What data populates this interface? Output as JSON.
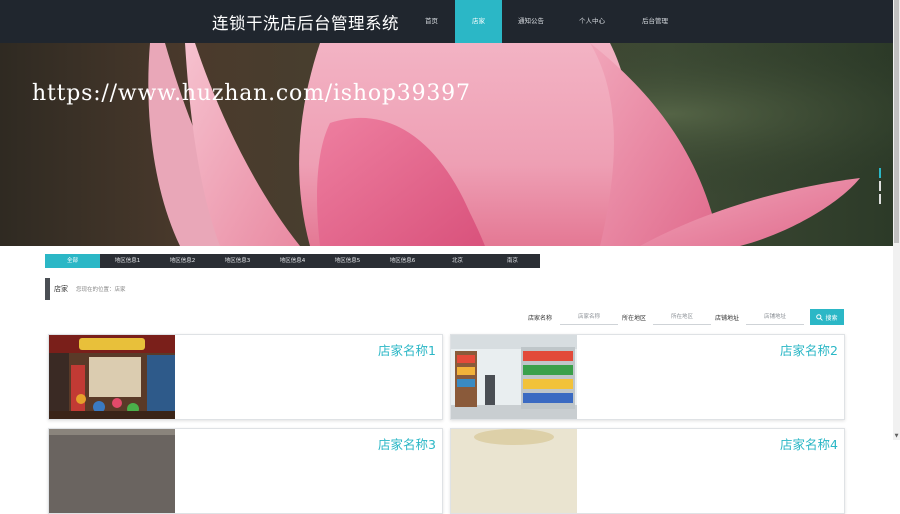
{
  "header": {
    "site_title": "连锁干洗店后台管理系统",
    "nav": [
      {
        "label": "首页",
        "active": false
      },
      {
        "label": "店家",
        "active": true
      },
      {
        "label": "通知公告",
        "active": false
      },
      {
        "label": "个人中心",
        "active": false
      },
      {
        "label": "后台管理",
        "active": false
      }
    ]
  },
  "banner": {
    "watermark": "https://www.huzhan.com/ishop39397",
    "active_slide": 1
  },
  "filter_tabs": [
    "全部",
    "地区信息1",
    "地区信息2",
    "地区信息3",
    "地区信息4",
    "地区信息5",
    "地区信息6",
    "北京",
    "南京"
  ],
  "breadcrumb": {
    "title": "店家",
    "location": "您现在的位置：店家"
  },
  "search": {
    "name_label": "店家名称",
    "name_placeholder": "店家名称",
    "region_label": "所在地区",
    "region_placeholder": "所在地区",
    "address_label": "店铺地址",
    "address_placeholder": "店铺地址",
    "button_label": "搜索",
    "button_icon": "search-icon"
  },
  "cards": [
    {
      "name": "店家名称1"
    },
    {
      "name": "店家名称2"
    },
    {
      "name": "店家名称3"
    },
    {
      "name": "店家名称4"
    }
  ],
  "colors": {
    "accent": "#2bb7c6",
    "header_bg": "#20262e",
    "tab_bar_bg": "#2a2e34"
  }
}
